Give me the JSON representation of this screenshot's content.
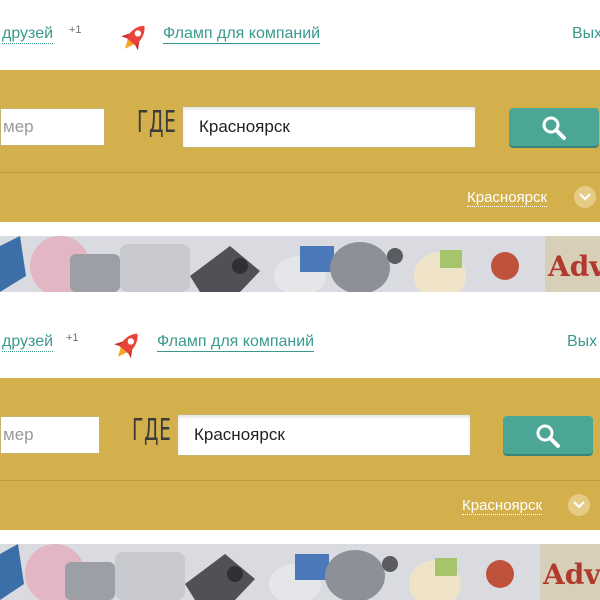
{
  "header": {
    "friends_link": "друзей",
    "friends_badge": "+1",
    "company_link": "Фламп для компаний",
    "logout_link": "Вых"
  },
  "search": {
    "what_value_partial": "мер",
    "where_label": "ГДЕ",
    "where_value": "Красноярск"
  },
  "city_selector": {
    "label": "Красноярск"
  },
  "icons": {
    "rocket": "rocket-icon",
    "search": "magnifier-icon",
    "chevron": "chevron-down-icon"
  },
  "colors": {
    "accent_teal": "#3a9a8d",
    "search_band": "#d4b04c",
    "search_button": "#4ba696"
  }
}
